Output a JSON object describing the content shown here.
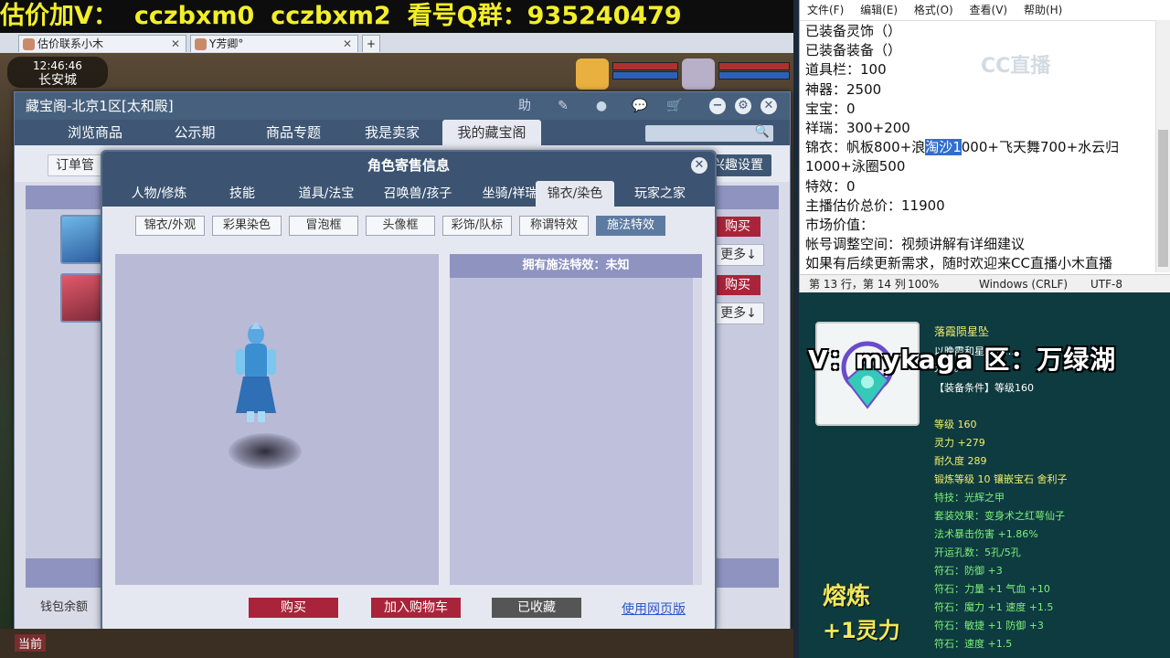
{
  "banner": {
    "part1": "估价加V：",
    "part2": "cczbxm0",
    "part3": "cczbxm2",
    "part4": "看号Q群：935240479"
  },
  "browser_tabs": [
    {
      "label": "估价联系小木"
    },
    {
      "label": "Y芳卿°"
    }
  ],
  "clock": {
    "time": "12:46:46",
    "city": "长安城"
  },
  "main_window": {
    "title": "藏宝阁-北京1区[太和殿]",
    "nav_tabs": [
      "浏览商品",
      "公示期",
      "商品专题",
      "我是卖家",
      "我的藏宝阁"
    ],
    "active_tab": "我的藏宝阁",
    "sub_left": "订单管",
    "sub_right": "兴趣设置",
    "rows": [
      {
        "buy": "购买",
        "more": "更多"
      },
      {
        "buy": "购买",
        "more": "更多"
      }
    ],
    "wallet_label": "钱包余额"
  },
  "dialog": {
    "title": "角色寄售信息",
    "tabs": [
      "人物/修炼",
      "技能",
      "道具/法宝",
      "召唤兽/孩子",
      "坐骑/祥瑞",
      "锦衣/染色",
      "玩家之家"
    ],
    "active_tab": "锦衣/染色",
    "sub_buttons": [
      "锦衣/外观",
      "彩果染色",
      "冒泡框",
      "头像框",
      "彩饰/队标",
      "称谓特效",
      "施法特效"
    ],
    "active_sub": "施法特效",
    "right_header": "拥有施法特效：未知",
    "actions": {
      "buy": "购买",
      "cart": "加入购物车",
      "favorited": "已收藏",
      "web": "使用网页版"
    }
  },
  "taskbar": {
    "current": "当前"
  },
  "notepad": {
    "menu": [
      "文件(F)",
      "编辑(E)",
      "格式(O)",
      "查看(V)",
      "帮助(H)"
    ],
    "lines": [
      "已装备灵饰（）",
      "已装备装备（）",
      "道具栏：100",
      "神器：2500",
      "宝宝：0",
      "祥瑞：300+200",
      "锦衣：帆板800+浪",
      "1000+泳圈500",
      "特效：0",
      "主播估价总价：11900",
      "市场价值：",
      "帐号调整空间：视频讲解有详细建议",
      "如果有后续更新需求，随时欢迎来CC直播小木直播"
    ],
    "line7_highlight": "淘沙1",
    "line7_tail": "000+飞天舞700+水云归",
    "watermark": "CC直播",
    "status": {
      "pos": "第 13 行，第 14 列",
      "zoom": "100%",
      "eol": "Windows (CRLF)",
      "enc": "UTF-8"
    }
  },
  "item": {
    "name": "落霞陨星坠",
    "desc": "以晚霞和星辰为…",
    "desc2": "光芒。",
    "cond": "【装备条件】等级160",
    "overlay": "V：mykaga  区：万绿湖",
    "stats": [
      "等级 160",
      "灵力 +279",
      "耐久度 289",
      "锻炼等级 10  镶嵌宝石 舍利子",
      "特技：光辉之甲",
      "套装效果：变身术之红萼仙子",
      "法术暴击伤害 +1.86%",
      "开运孔数：5孔/5孔",
      "符石：防御 +3",
      "符石：力量 +1  气血 +10",
      "符石：魔力 +1  速度 +1.5",
      "符石：敏捷 +1  防御 +3",
      "符石：速度 +1.5"
    ],
    "smelt_label": "熔炼",
    "smelt_value": "+1灵力"
  }
}
